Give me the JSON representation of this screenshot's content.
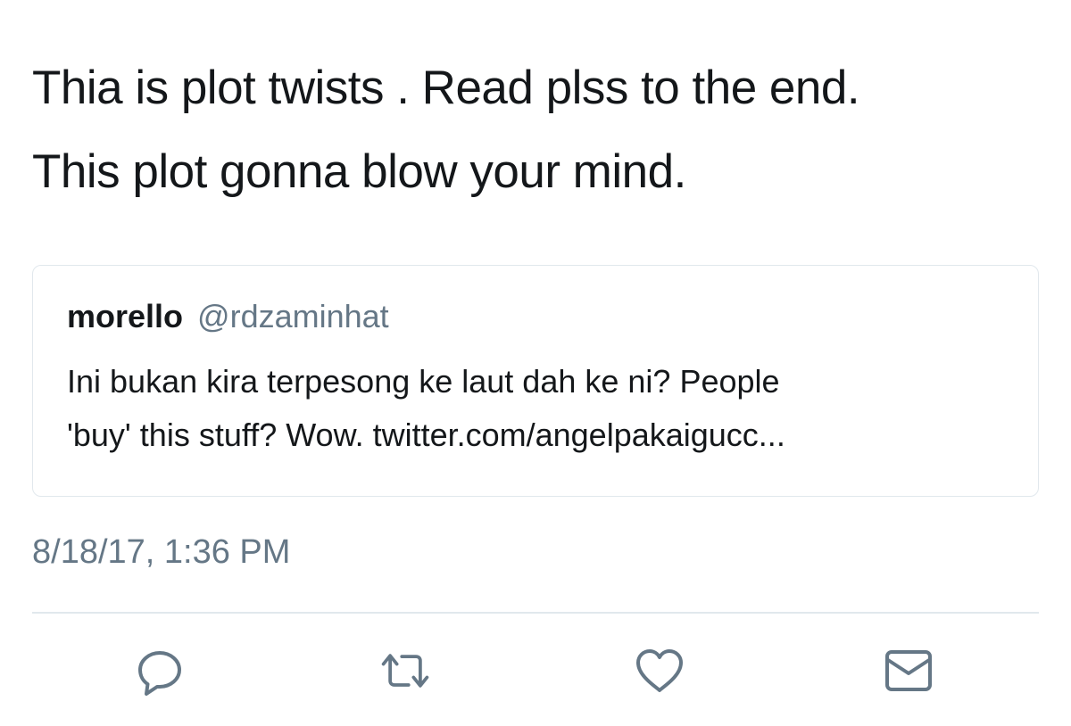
{
  "tweet": {
    "text_lines": [
      "Thia is plot twists . Read plss to the end.",
      "This plot gonna blow your mind."
    ],
    "timestamp": "8/18/17, 1:36 PM"
  },
  "quoted_tweet": {
    "name": "morello",
    "handle": "@rdzaminhat",
    "text_lines": [
      "Ini bukan kira terpesong ke laut dah ke ni? People",
      "'buy' this stuff? Wow. twitter.com/angelpakaigucc..."
    ]
  },
  "actions": [
    {
      "name": "reply",
      "icon": "reply-icon"
    },
    {
      "name": "retweet",
      "icon": "retweet-icon"
    },
    {
      "name": "like",
      "icon": "heart-icon"
    },
    {
      "name": "direct-message",
      "icon": "envelope-icon"
    }
  ],
  "colors": {
    "text": "#14171a",
    "secondary": "#657786",
    "border": "#e1e8ed",
    "icon": "#657786"
  }
}
